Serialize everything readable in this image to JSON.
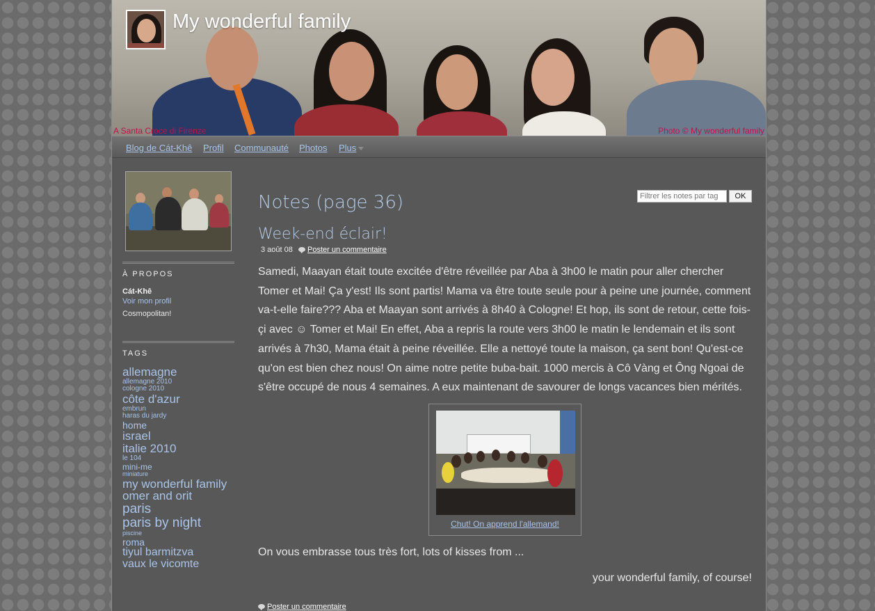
{
  "header": {
    "site_title": "My wonderful family",
    "caption_left": "A Santa Croce di Firenze",
    "caption_right": "Photo © My wonderful family"
  },
  "nav": {
    "items": [
      {
        "label": "Blog de Cát-Khê"
      },
      {
        "label": "Profil"
      },
      {
        "label": "Communauté"
      },
      {
        "label": "Photos"
      },
      {
        "label": "Plus"
      }
    ]
  },
  "sidebar": {
    "about_heading": "À PROPOS",
    "about_name": "Cát-Khê",
    "about_link": "Voir mon profil",
    "about_desc": "Cosmopolitan!",
    "tags_heading": "TAGS",
    "tags": [
      {
        "label": "allemagne",
        "size": 17
      },
      {
        "label": "allemagne 2010",
        "size": 10
      },
      {
        "label": "cologne 2010",
        "size": 10
      },
      {
        "label": "côte d'azur",
        "size": 17
      },
      {
        "label": "embrun",
        "size": 10
      },
      {
        "label": "haras du jardy",
        "size": 10
      },
      {
        "label": "home",
        "size": 14
      },
      {
        "label": "israel",
        "size": 17
      },
      {
        "label": "italie 2010",
        "size": 17
      },
      {
        "label": "le 104",
        "size": 10
      },
      {
        "label": "mini-me",
        "size": 12
      },
      {
        "label": "miniature",
        "size": 9
      },
      {
        "label": "my wonderful family",
        "size": 17
      },
      {
        "label": "omer and orit",
        "size": 17
      },
      {
        "label": "paris",
        "size": 19
      },
      {
        "label": "paris by night",
        "size": 19
      },
      {
        "label": "piscine",
        "size": 9
      },
      {
        "label": "roma",
        "size": 14
      },
      {
        "label": "tiyul barmitzva",
        "size": 16
      },
      {
        "label": "vaux le vicomte",
        "size": 16
      }
    ]
  },
  "main": {
    "page_title": "Notes (page 36)",
    "tag_filter_placeholder": "Filtrer les notes par tag",
    "ok_label": "OK",
    "post": {
      "title": "Week-end éclair!",
      "date": "3 août 08",
      "comment_label": "Poster un commentaire",
      "body": "Samedi, Maayan était toute excitée d'être réveillée par Aba à 3h00 le matin pour aller chercher Tomer et Mai! Ça y'est! Ils sont partis! Mama va être toute seule pour à peine une journée, comment va-t-elle faire??? Aba et Maayan sont arrivés à 8h40 à Cologne! Et hop, ils sont de retour, cette fois-çi avec ☺ Tomer et Mai! En effet, Aba a repris la route vers 3h00 le matin le lendemain et ils sont arrivés à 7h30, Mama était à peine réveillée. Elle a nettoyé toute la maison, ça sent bon! Qu'est-ce qu'on est bien chez nous! On aime notre petite buba-bait. 1000 mercis à Cô Vàng et Ông Ngoai de s'être occupé de nous 4 semaines. A eux maintenant de savourer de longs vacances bien mérités.",
      "photo_caption": "Chut! On apprend l'allemand!",
      "closing": "On vous embrasse tous très fort, lots of kisses from ...",
      "signature": "your wonderful family, of course!",
      "comment_label_bottom": "Poster un commentaire"
    }
  },
  "colors": {
    "link": "#a9c4e8",
    "title": "#b6cde8",
    "caption": "#c0134a",
    "panel": "#585858"
  }
}
